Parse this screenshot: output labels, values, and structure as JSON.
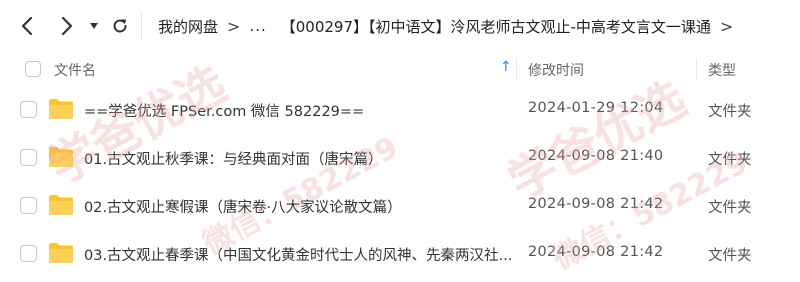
{
  "toolbar": {
    "back_icon": "chevron-left-icon",
    "forward_icon": "chevron-right-icon",
    "history_icon": "caret-down-icon",
    "refresh_icon": "refresh-icon"
  },
  "breadcrumb": {
    "root": "我的网盘",
    "ellipsis": "...",
    "current": "【000297】【初中语文】泠风老师古文观止-中高考文言文一课通",
    "separator": ">"
  },
  "header": {
    "name_label": "文件名",
    "sort_indicator": "↑",
    "time_label": "修改时间",
    "type_label": "类型"
  },
  "files": [
    {
      "name": "==学爸优选 FPSer.com 微信 582229==",
      "modified": "2024-01-29 12:04",
      "type": "文件夹",
      "icon": "folder-icon"
    },
    {
      "name": "01.古文观止秋季课：与经典面对面（唐宋篇）",
      "modified": "2024-09-08 21:40",
      "type": "文件夹",
      "icon": "folder-icon"
    },
    {
      "name": "02.古文观止寒假课（唐宋卷·八大家议论散文篇）",
      "modified": "2024-09-08 21:42",
      "type": "文件夹",
      "icon": "folder-icon"
    },
    {
      "name": "03.古文观止春季课（中国文化黄金时代士人的风神、先秦两汉社...",
      "modified": "2024-09-08 21:42",
      "type": "文件夹",
      "icon": "folder-icon"
    }
  ],
  "watermark": {
    "text": "学爸优选",
    "sub_text": "微信：582229",
    "color": "#e8a0a0"
  },
  "colors": {
    "folder": "#f9c336",
    "accent": "#2d8cf0"
  }
}
